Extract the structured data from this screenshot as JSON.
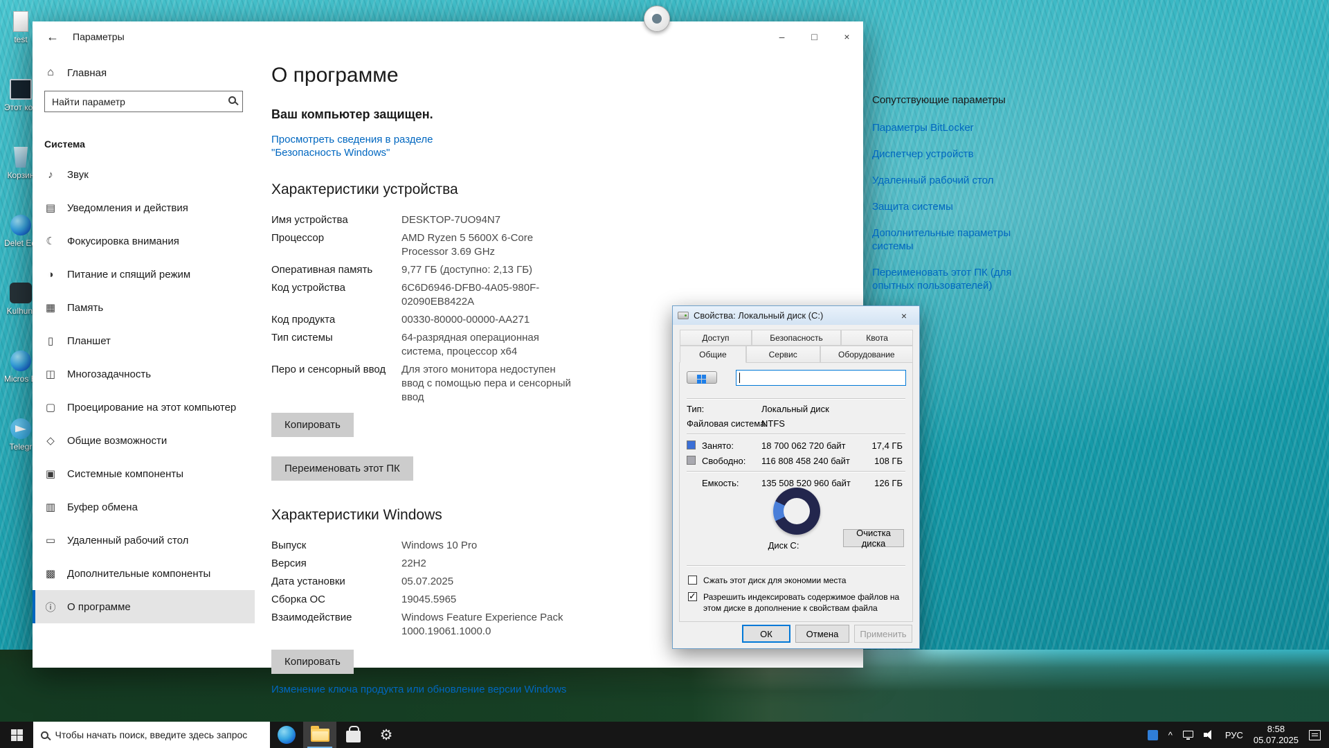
{
  "desktop": {
    "icons": [
      {
        "icon": "file-icon",
        "label": "test"
      },
      {
        "icon": "this-pc-icon",
        "label": "Этот компью"
      },
      {
        "icon": "recycle-bin-icon",
        "label": "Корзин"
      },
      {
        "icon": "edge-shortcut-icon",
        "label": "Delet EdgeW"
      },
      {
        "icon": "app-icon",
        "label": "Kulhunt"
      },
      {
        "icon": "edge-icon",
        "label": "Micros Edge"
      },
      {
        "icon": "telegram-icon",
        "label": "Telegr"
      }
    ]
  },
  "settings": {
    "window_title": "Параметры",
    "titlebar": {
      "back": "←",
      "minimize": "–",
      "maximize": "□",
      "close": "×"
    },
    "sidebar": {
      "home": "Главная",
      "home_glyph": "⌂",
      "search_placeholder": "Найти параметр",
      "section": "Система",
      "items": [
        {
          "icon": "sound-icon",
          "glyph": "♪",
          "label": "Звук"
        },
        {
          "icon": "notifications-icon",
          "glyph": "▤",
          "label": "Уведомления и действия"
        },
        {
          "icon": "focus-assist-icon",
          "glyph": "☾",
          "label": "Фокусировка внимания"
        },
        {
          "icon": "power-sleep-icon",
          "glyph": "◑",
          "label": "Питание и спящий режим"
        },
        {
          "icon": "storage-icon",
          "glyph": "▦",
          "label": "Память"
        },
        {
          "icon": "tablet-icon",
          "glyph": "▯",
          "label": "Планшет"
        },
        {
          "icon": "multitasking-icon",
          "glyph": "◫",
          "label": "Многозадачность"
        },
        {
          "icon": "projecting-icon",
          "glyph": "▢",
          "label": "Проецирование на этот компьютер"
        },
        {
          "icon": "shared-experiences-icon",
          "glyph": "◇",
          "label": "Общие возможности"
        },
        {
          "icon": "system-components-icon",
          "glyph": "▣",
          "label": "Системные компоненты"
        },
        {
          "icon": "clipboard-icon",
          "glyph": "▥",
          "label": "Буфер обмена"
        },
        {
          "icon": "remote-desktop-icon",
          "glyph": "▭",
          "label": "Удаленный рабочий стол"
        },
        {
          "icon": "optional-features-icon",
          "glyph": "▩",
          "label": "Дополнительные компоненты"
        },
        {
          "icon": "about-icon",
          "glyph": "ⓘ",
          "label": "О программе",
          "selected": true
        }
      ]
    },
    "main": {
      "page_title": "О программе",
      "protected": "Ваш компьютер защищен.",
      "security_link": "Просмотреть сведения в разделе \"Безопасность Windows\"",
      "device_specs_title": "Характеристики устройства",
      "device_specs": [
        {
          "label": "Имя устройства",
          "value": "DESKTOP-7UO94N7"
        },
        {
          "label": "Процессор",
          "value": "AMD Ryzen 5 5600X 6-Core Processor 3.69 GHz"
        },
        {
          "label": "Оперативная память",
          "value": "9,77 ГБ (доступно: 2,13 ГБ)"
        },
        {
          "label": "Код устройства",
          "value": "6C6D6946-DFB0-4A05-980F-02090EB8422A"
        },
        {
          "label": "Код продукта",
          "value": "00330-80000-00000-AA271"
        },
        {
          "label": "Тип системы",
          "value": "64-разрядная операционная система, процессор x64"
        },
        {
          "label": "Перо и сенсорный ввод",
          "value": "Для этого монитора недоступен ввод с помощью пера и сенсорный ввод"
        }
      ],
      "copy_button": "Копировать",
      "rename_button": "Переименовать этот ПК",
      "windows_specs_title": "Характеристики Windows",
      "windows_specs": [
        {
          "label": "Выпуск",
          "value": "Windows 10 Pro"
        },
        {
          "label": "Версия",
          "value": "22H2"
        },
        {
          "label": "Дата установки",
          "value": "05.07.2025"
        },
        {
          "label": "Сборка ОС",
          "value": "19045.5965"
        },
        {
          "label": "Взаимодействие",
          "value": "Windows Feature Experience Pack 1000.19061.1000.0"
        }
      ],
      "copy_button2": "Копировать",
      "change_key_link": "Изменение ключа продукта или обновление версии Windows"
    },
    "related": {
      "title": "Сопутствующие параметры",
      "links": [
        "Параметры BitLocker",
        "Диспетчер устройств",
        "Удаленный рабочий стол",
        "Защита системы",
        "Дополнительные параметры системы",
        "Переименовать этот ПК (для опытных пользователей)"
      ]
    },
    "accent_color": "#0067C0"
  },
  "dialog": {
    "title": "Свойства: Локальный диск (C:)",
    "close": "×",
    "tabs_back": [
      "Доступ",
      "Безопасность",
      "Квота"
    ],
    "tabs_front": [
      "Общие",
      "Сервис",
      "Оборудование"
    ],
    "label_input_value": "",
    "type_label": "Тип:",
    "type_value": "Локальный диск",
    "fs_label": "Файловая система:",
    "fs_value": "NTFS",
    "used_label": "Занято:",
    "used_bytes": "18 700 062 720 байт",
    "used_size": "17,4 ГБ",
    "free_label": "Свободно:",
    "free_bytes": "116 808 458 240 байт",
    "free_size": "108 ГБ",
    "capacity_label": "Емкость:",
    "capacity_bytes": "135 508 520 960 байт",
    "capacity_size": "126 ГБ",
    "disk_label": "Диск C:",
    "cleanup_button": "Очистка диска",
    "compress_checkbox": {
      "checked": false,
      "label": "Сжать этот диск для экономии места"
    },
    "index_checkbox": {
      "checked": true,
      "label": "Разрешить индексировать содержимое файлов на этом диске в дополнение к свойствам файла"
    },
    "ok": "ОК",
    "cancel": "Отмена",
    "apply": "Применить",
    "colors": {
      "used": "#4a7fd9",
      "free": "#23264d",
      "used_swatch": "#3b6fd6",
      "free_swatch": "#a9a9b0"
    }
  },
  "taskbar": {
    "search_placeholder": "Чтобы начать поиск, введите здесь запрос",
    "apps": [
      "edge",
      "file-explorer",
      "store",
      "settings"
    ],
    "active_app": "file-explorer",
    "tray": {
      "caret": "^",
      "language": "РУС",
      "time": "8:58",
      "date": "05.07.2025"
    }
  }
}
